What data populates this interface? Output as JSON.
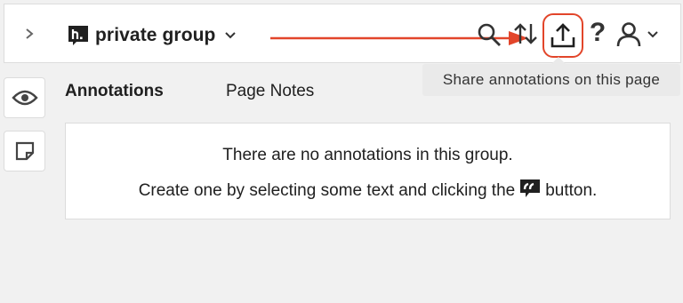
{
  "header": {
    "group_name": "private group",
    "share_tooltip": "Share annotations on this page"
  },
  "tabs": [
    {
      "label": "Annotations",
      "selected": true
    },
    {
      "label": "Page Notes",
      "selected": false
    }
  ],
  "empty_state": {
    "line1": "There are no annotations in this group.",
    "line2_before": "Create one by selecting some text and clicking the",
    "line2_after": "button."
  },
  "colors": {
    "highlight": "#e2452a",
    "panel_background": "#f1f1f1"
  },
  "icons": {
    "sidebar_toggle": "chevron-right-icon",
    "brand": "hypothesis-logo-icon",
    "search": "search-icon",
    "sort": "sort-icon",
    "share": "share-icon",
    "help": "help-icon",
    "user": "user-icon",
    "annotations_rail": "eye-icon",
    "notes_rail": "note-icon",
    "annotate_button": "quote-icon"
  }
}
